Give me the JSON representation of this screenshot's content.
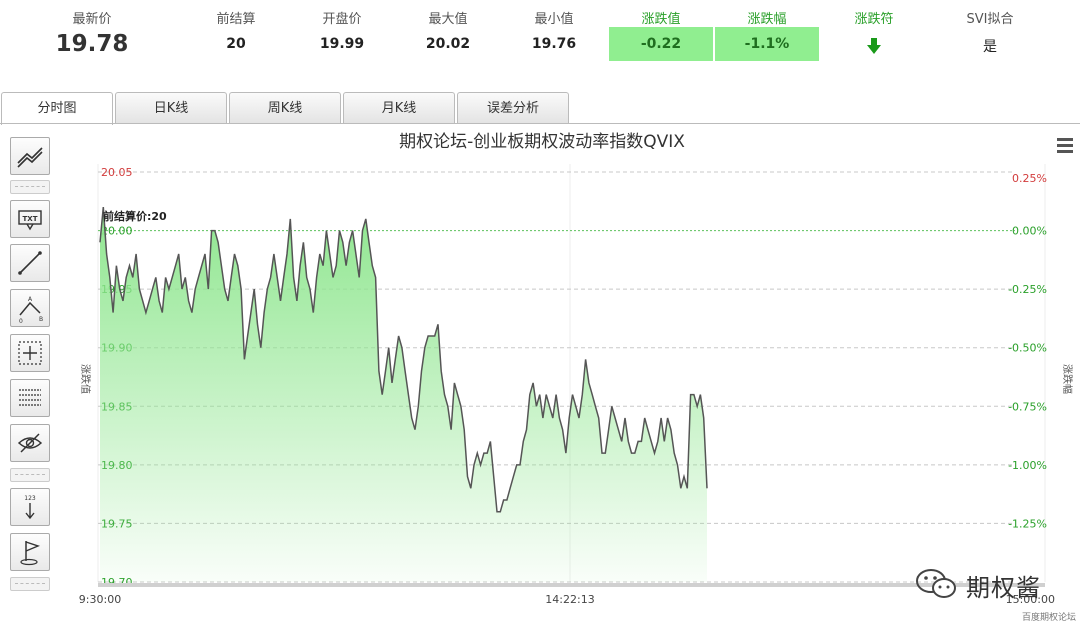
{
  "stats": [
    {
      "label": "最新价",
      "value": "19.78"
    },
    {
      "label": "前结算",
      "value": "20"
    },
    {
      "label": "开盘价",
      "value": "19.99"
    },
    {
      "label": "最大值",
      "value": "20.02"
    },
    {
      "label": "最小值",
      "value": "19.76"
    },
    {
      "label": "涨跌值",
      "value": "-0.22"
    },
    {
      "label": "涨跌幅",
      "value": "-1.1%"
    },
    {
      "label": "涨跌符",
      "value": ""
    },
    {
      "label": "SVI拟合",
      "value": "是"
    }
  ],
  "tabs": [
    "分时图",
    "日K线",
    "周K线",
    "月K线",
    "误差分析"
  ],
  "colors": {
    "up": "#d23c3c",
    "down": "#2aa02a",
    "area_top": "#8fe68f",
    "line": "#555555",
    "gain_box": "#90ee90"
  },
  "icons": [
    "trend-lines-icon",
    "text-icon",
    "line-icon",
    "fib-icon",
    "crosshair-icon",
    "parallel-lines-icon",
    "hide-icon",
    "measure-icon",
    "flag-icon"
  ],
  "watermark": {
    "text": "期权酱",
    "sub": "百度期权论坛"
  },
  "chart_data": {
    "type": "area",
    "title": "期权论坛-创业板期权波动率指数QVIX",
    "ylabel": "涨跌值",
    "ylabel_right": "涨跌幅",
    "ylim": [
      19.7,
      20.05
    ],
    "yticks": [
      "20.05",
      "20.00",
      "19.95",
      "19.90",
      "19.85",
      "19.80",
      "19.75",
      "19.70"
    ],
    "yticks_right": [
      "0.25%",
      "0.00%",
      "-0.25%",
      "-0.50%",
      "-0.75%",
      "-1.00%",
      "-1.25%"
    ],
    "xticks": [
      "9:30:00",
      "14:22:13",
      "15:00:00"
    ],
    "reference": {
      "label": "前结算价:20",
      "value": 20.0
    },
    "values": [
      19.99,
      20.02,
      19.98,
      19.96,
      19.93,
      19.97,
      19.95,
      19.94,
      19.96,
      19.97,
      19.96,
      19.98,
      19.95,
      19.94,
      19.93,
      19.94,
      19.95,
      19.96,
      19.94,
      19.93,
      19.96,
      19.95,
      19.96,
      19.97,
      19.98,
      19.95,
      19.96,
      19.94,
      19.93,
      19.95,
      19.96,
      19.97,
      19.98,
      19.95,
      20.0,
      20.0,
      19.99,
      19.97,
      19.95,
      19.94,
      19.96,
      19.98,
      19.97,
      19.95,
      19.89,
      19.91,
      19.93,
      19.95,
      19.92,
      19.9,
      19.93,
      19.95,
      19.96,
      19.98,
      19.96,
      19.94,
      19.96,
      19.98,
      20.01,
      19.96,
      19.94,
      19.97,
      19.99,
      19.96,
      19.95,
      19.93,
      19.96,
      19.98,
      19.97,
      20.0,
      19.98,
      19.96,
      19.97,
      20.0,
      19.99,
      19.97,
      19.99,
      20.0,
      19.98,
      19.96,
      20.0,
      20.01,
      19.99,
      19.97,
      19.96,
      19.88,
      19.86,
      19.88,
      19.9,
      19.87,
      19.89,
      19.91,
      19.9,
      19.88,
      19.86,
      19.84,
      19.83,
      19.85,
      19.88,
      19.9,
      19.91,
      19.91,
      19.91,
      19.92,
      19.88,
      19.86,
      19.85,
      19.83,
      19.87,
      19.86,
      19.85,
      19.83,
      19.79,
      19.78,
      19.8,
      19.81,
      19.8,
      19.81,
      19.81,
      19.82,
      19.79,
      19.76,
      19.76,
      19.77,
      19.77,
      19.78,
      19.79,
      19.8,
      19.8,
      19.82,
      19.83,
      19.86,
      19.87,
      19.85,
      19.86,
      19.84,
      19.86,
      19.85,
      19.84,
      19.86,
      19.84,
      19.83,
      19.81,
      19.84,
      19.86,
      19.85,
      19.84,
      19.86,
      19.89,
      19.87,
      19.86,
      19.85,
      19.84,
      19.81,
      19.81,
      19.83,
      19.85,
      19.84,
      19.83,
      19.82,
      19.84,
      19.82,
      19.81,
      19.81,
      19.82,
      19.82,
      19.84,
      19.83,
      19.82,
      19.81,
      19.82,
      19.84,
      19.82,
      19.84,
      19.83,
      19.81,
      19.8,
      19.78,
      19.79,
      19.78,
      19.86,
      19.86,
      19.85,
      19.86,
      19.84,
      19.78
    ]
  }
}
